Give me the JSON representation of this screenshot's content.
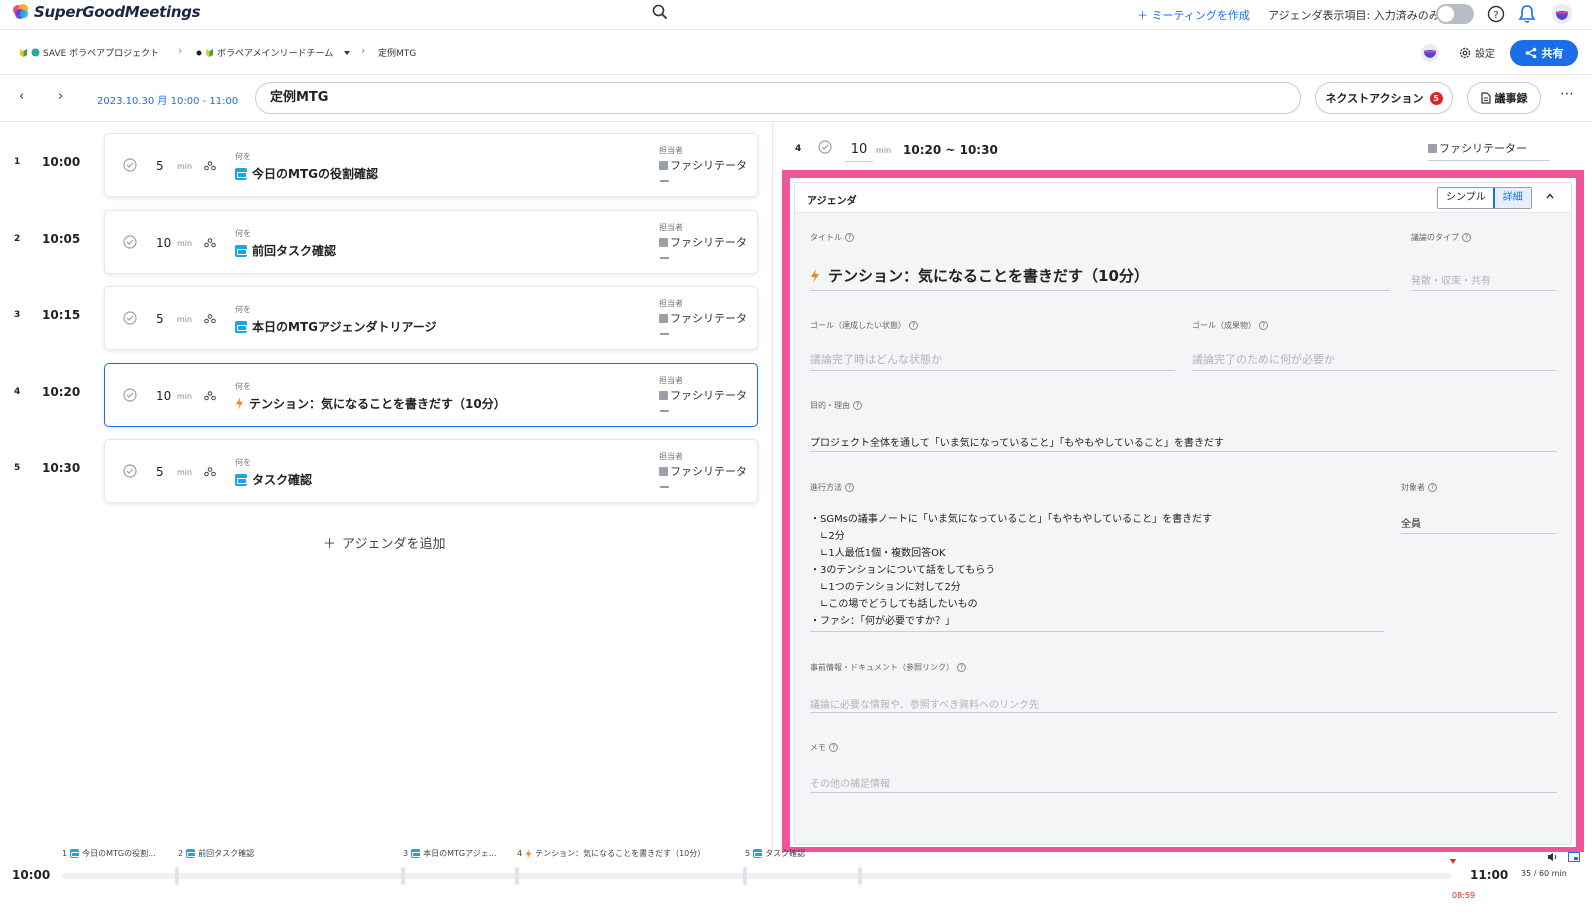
{
  "app": {
    "name": "SuperGoodMeetings",
    "create_meeting": "＋ ミーティングを作成",
    "agenda_display": "アジェンダ表示項目: 入力済みのみ",
    "accent_color": "#1a6fe8",
    "highlight_color": "#f0559a"
  },
  "breadcrumb": {
    "project": "SAVE ボラペアプロジェクト",
    "team": "ボラペアメインリードチーム",
    "meeting": "定例MTG"
  },
  "header_actions": {
    "settings": "設定",
    "share": "共有"
  },
  "meeting": {
    "date": "2023.10.30 月 10:00 - 11:00",
    "title": "定例MTG",
    "next_action": "ネクストアクション",
    "next_action_count": "5",
    "minutes": "議事録"
  },
  "agenda_items": [
    {
      "num": "1",
      "time": "10:00",
      "duration": "5",
      "unit": "min",
      "what_label": "何を",
      "title": "今日のMTGの役割確認",
      "owner_label": "担当者",
      "owner": "ファシリテーター",
      "icon": "discuss-icon"
    },
    {
      "num": "2",
      "time": "10:05",
      "duration": "10",
      "unit": "min",
      "what_label": "何を",
      "title": "前回タスク確認",
      "owner_label": "担当者",
      "owner": "ファシリテーター",
      "icon": "discuss-icon"
    },
    {
      "num": "3",
      "time": "10:15",
      "duration": "5",
      "unit": "min",
      "what_label": "何を",
      "title": "本日のMTGアジェンダトリアージ",
      "owner_label": "担当者",
      "owner": "ファシリテーター",
      "icon": "discuss-icon"
    },
    {
      "num": "4",
      "time": "10:20",
      "duration": "10",
      "unit": "min",
      "what_label": "何を",
      "title": "テンション：気になることを書きだす（10分）",
      "owner_label": "担当者",
      "owner": "ファシリテーター",
      "icon": "lightning-icon"
    },
    {
      "num": "5",
      "time": "10:30",
      "duration": "5",
      "unit": "min",
      "what_label": "何を",
      "title": "タスク確認",
      "owner_label": "担当者",
      "owner": "ファシリテーター",
      "icon": "discuss-icon"
    }
  ],
  "add_agenda": "アジェンダを追加",
  "detail": {
    "num": "4",
    "duration": "10",
    "unit": "min",
    "range": "10:20 ~ 10:30",
    "owner": "ファシリテーター",
    "panel_title": "アジェンダ",
    "view_simple": "シンプル",
    "view_detail": "詳細",
    "fields": {
      "title_label": "タイトル",
      "title_value": "テンション：気になることを書きだす（10分）",
      "type_label": "議論のタイプ",
      "type_placeholder": "発散・収束・共有",
      "goal_state_label": "ゴール（達成したい状態）",
      "goal_state_placeholder": "議論完了時はどんな状態か",
      "goal_output_label": "ゴール（成果物）",
      "goal_output_placeholder": "議論完了のために何が必要か",
      "purpose_label": "目的・理由",
      "purpose_value": "プロジェクト全体を通して「いま気になっていること」「もやもやしていること」を書きだす",
      "method_label": "進行方法",
      "method_lines": [
        "・SGMsの議事ノートに「いま気になっていること」「もやもやしていること」を書きだす",
        "　∟2分",
        "　∟1人最低1個・複数回答OK",
        "・3のテンションについて話をしてもらう",
        "　∟1つのテンションに対して2分",
        "　∟この場でどうしても話したいもの",
        "・ファシ：「何が必要ですか？」"
      ],
      "target_label": "対象者",
      "target_value": "全員",
      "docs_label": "事前情報・ドキュメント（参照リンク）",
      "docs_placeholder": "議論に必要な情報や、参照すべき資料へのリンク先",
      "memo_label": "メモ",
      "memo_placeholder": "その他の補足情報"
    }
  },
  "timeline": {
    "start": "10:00",
    "end": "11:00",
    "now": "08:59",
    "count": "35 / 60 min",
    "items": [
      {
        "num": "1",
        "title": "今日のMTGの役割..."
      },
      {
        "num": "2",
        "title": "前回タスク確認"
      },
      {
        "num": "3",
        "title": "本日のMTGアジェ..."
      },
      {
        "num": "4",
        "title": "テンション：気になることを書きだす（10分）"
      },
      {
        "num": "5",
        "title": "タスク確認"
      }
    ]
  }
}
